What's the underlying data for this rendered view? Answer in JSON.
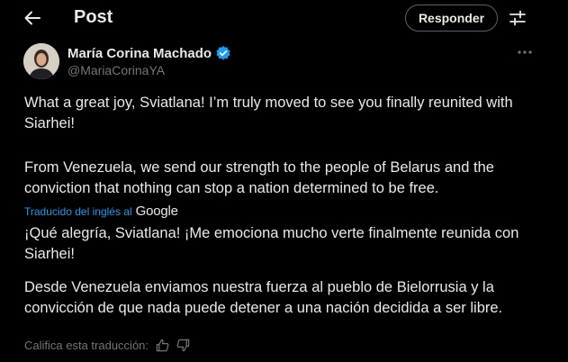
{
  "header": {
    "title": "Post",
    "reply_label": "Responder"
  },
  "author": {
    "name": "María Corina Machado",
    "handle": "@MariaCorinaYA"
  },
  "tweet": {
    "para1": "What a great joy, Sviatlana! I’m truly moved to see you finally reunited with Siarhei!",
    "para2": "From Venezuela, we send our strength to the people of Belarus and the conviction that nothing can stop a nation determined to be free."
  },
  "translation": {
    "credit_label": "Traducido del inglés al",
    "provider": "Google",
    "para1": "¡Qué alegría, Sviatlana! ¡Me emociona mucho verte finalmente reunida con Siarhei!",
    "para2": "Desde Venezuela enviamos nuestra fuerza al pueblo de Bielorrusia y la convicción de que nada puede detener a una nación decidida a ser libre.",
    "rate_label": "Califica esta traducción:"
  },
  "colors": {
    "background": "#000000",
    "text": "#e7e9ea",
    "muted": "#71767b",
    "accent": "#1d9bf0"
  },
  "icons": [
    "back-arrow-icon",
    "filter-icon",
    "verified-badge-icon",
    "more-icon",
    "thumbs-up-icon",
    "thumbs-down-icon"
  ]
}
